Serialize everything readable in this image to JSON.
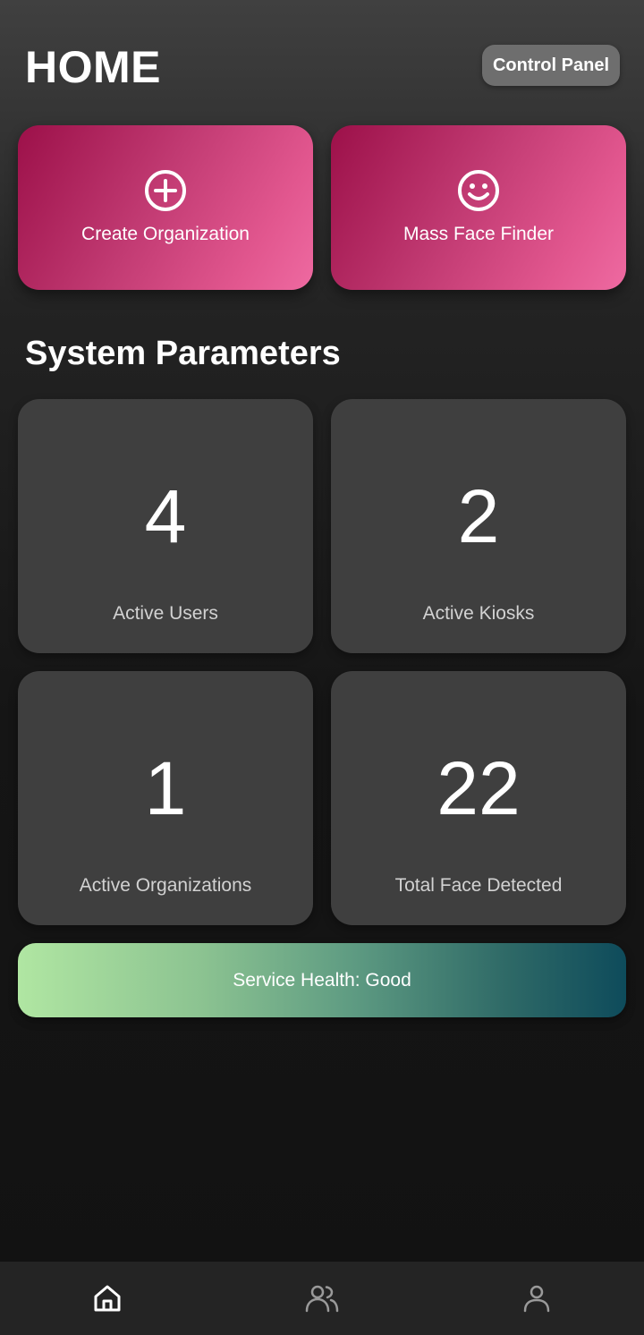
{
  "header": {
    "title": "HOME",
    "control_panel_label": "Control Panel"
  },
  "actions": [
    {
      "label": "Create Organization",
      "icon": "plus-circle-icon"
    },
    {
      "label": "Mass Face Finder",
      "icon": "smiley-face-icon"
    }
  ],
  "system_parameters": {
    "title": "System Parameters",
    "stats": [
      {
        "value": "4",
        "label": "Active Users"
      },
      {
        "value": "2",
        "label": "Active Kiosks"
      },
      {
        "value": "1",
        "label": "Active Organizations"
      },
      {
        "value": "22",
        "label": "Total Face Detected"
      }
    ]
  },
  "service_health": {
    "label": "Service Health: Good"
  },
  "bottom_nav": {
    "items": [
      {
        "icon": "home-icon",
        "active": true
      },
      {
        "icon": "users-icon",
        "active": false
      },
      {
        "icon": "profile-icon",
        "active": false
      }
    ]
  },
  "colors": {
    "accent_gradient_start": "#9c1049",
    "accent_gradient_end": "#ee6aa1",
    "card_background": "#3f3f3f",
    "health_gradient_start": "#b0e6a2",
    "health_gradient_end": "#0e4b5b",
    "nav_active": "#ffffff",
    "nav_inactive": "#9a9a9a"
  }
}
